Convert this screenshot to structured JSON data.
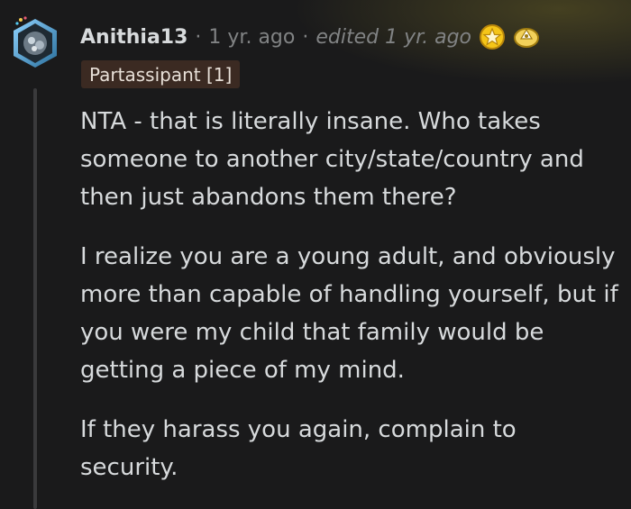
{
  "comment": {
    "username": "Anithia13",
    "separator": "·",
    "timestamp": "1 yr. ago",
    "edited": "edited 1 yr. ago",
    "flair": "Partassipant [1]",
    "awards": [
      "gold-award-icon",
      "helpful-award-icon"
    ],
    "paragraphs": [
      "NTA - that is literally insane. Who takes someone to another city/state/country and then just abandons them there?",
      "I realize you are a young adult, and obviously more than capable of handling yourself, but if you were my child that family would be getting a piece of my mind.",
      "If they harass you again, complain to security."
    ]
  },
  "colors": {
    "background": "#1a1a1b",
    "text": "#d7dadc",
    "meta": "#818384",
    "flair_bg": "#3b2a22",
    "thread_line": "#3a3a3c"
  }
}
